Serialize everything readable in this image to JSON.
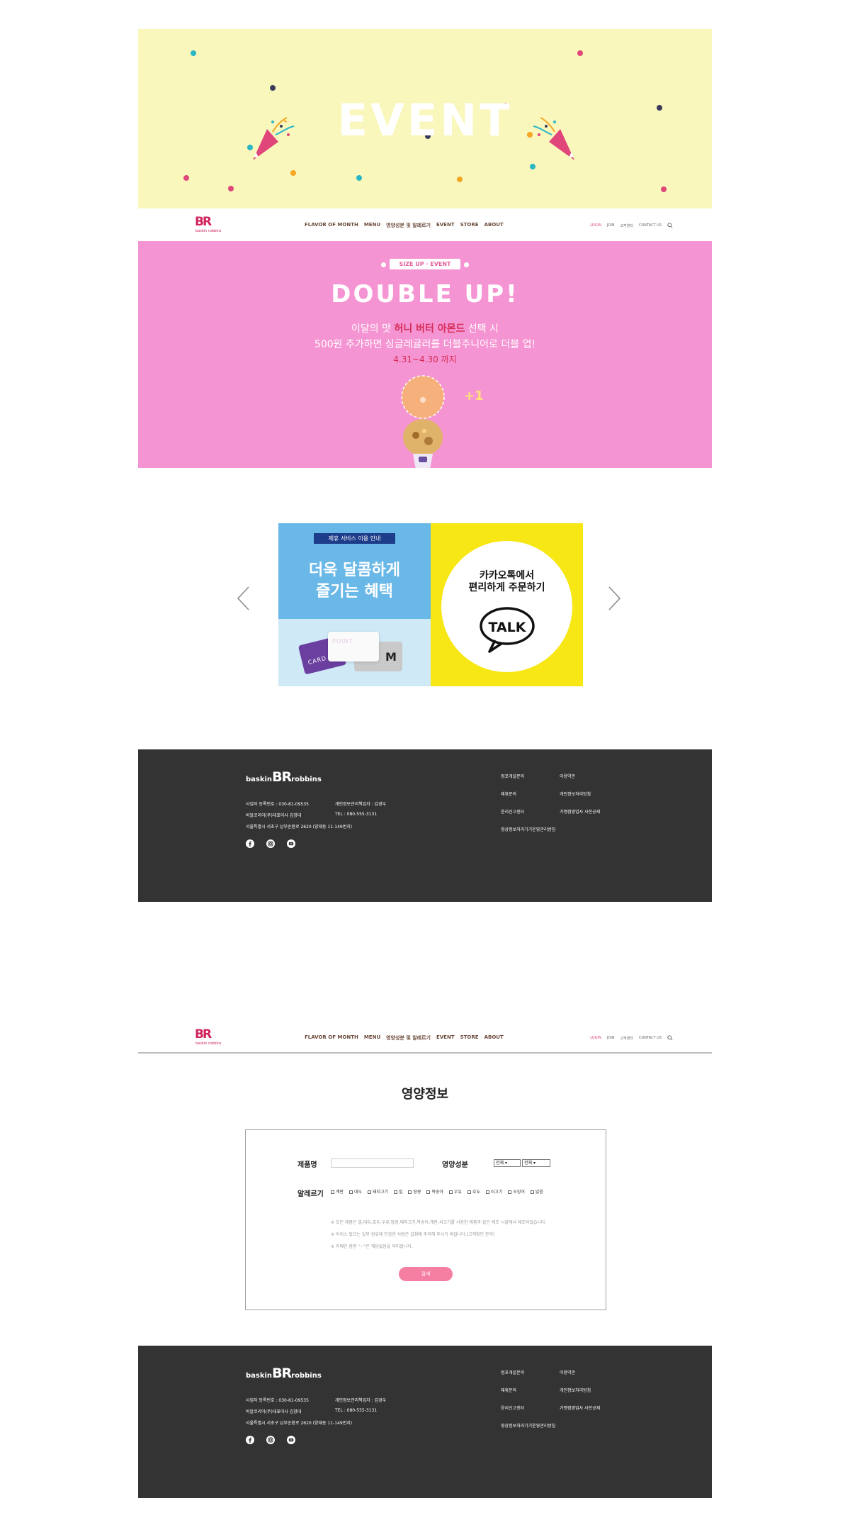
{
  "colors": {
    "hero_bg": "#f9f7bb",
    "promo_bg": "#f594d2",
    "footer_bg": "#333333",
    "brand_pink": "#d0245b",
    "brand_blue": "#2b4fa8",
    "search_button": "#f57ea3"
  },
  "hero": {
    "title": "EVENT"
  },
  "nav": {
    "logo_mark": "BR",
    "logo_sub": "baskin robbins",
    "menu": [
      "FLAVOR OF MONTH",
      "MENU",
      "영양성분 및 알레르기",
      "EVENT",
      "STORE",
      "ABOUT"
    ],
    "util": [
      "LOGIN",
      "JOIN",
      "고객센터",
      "CONTACT US"
    ],
    "search_icon": "search-icon"
  },
  "promo": {
    "badge": "SIZE UP · EVENT",
    "title": "DOUBLE  UP!",
    "line1_pre": "이달의 맛 ",
    "line1_highlight": "허니 버터 아몬드",
    "line1_post": " 선택 시",
    "line2": "500원 추가하면 싱글레귤러를 더블주니어로 더블 업!",
    "date": "4.31~4.30 까지",
    "plus": "+1"
  },
  "slider": {
    "left": {
      "ribbon": "제휴 서비스 이용 안내",
      "title_line1": "더욱 달콤하게",
      "title_line2": "즐기는 혜택",
      "card1": "CARD",
      "card2": "POINT",
      "card3": "M"
    },
    "right": {
      "line1": "카카오톡에서",
      "line2": "편리하게 주문하기",
      "talk": "TALK"
    }
  },
  "footer": {
    "logo_left": "baskin",
    "logo_mark": "BR",
    "logo_right": "robbins",
    "reg_no": "사업자 등록번호 : 030-81-09535",
    "privacy_officer": "개인정보관리책임자 : 김경우",
    "company": "비알코리아(주)대표이사 김창대",
    "tel": "TEL : 080-555-3131",
    "address": "서울특별시 서초구 남부순환로 2620 (양재동 11-149번지)",
    "links": [
      "점포개설문의",
      "이용약관",
      "제휴문의",
      "개인정보처리방침",
      "윤리신고센터",
      "가맹점영업사 사전공재",
      "영상정보처리기기운영관리방침"
    ],
    "social": [
      "facebook-icon",
      "instagram-icon",
      "youtube-icon"
    ]
  },
  "nutrition": {
    "title": "영양정보",
    "product_label": "제품명",
    "product_value": "",
    "nutrient_label": "영양성분",
    "select1": "전체",
    "select2": "전체",
    "allergy_label": "알레르기",
    "allergies": [
      "계란",
      "대두",
      "돼지고기",
      "밀",
      "땅콩",
      "복숭아",
      "우유",
      "호두",
      "쇠고기",
      "오징어",
      "없음"
    ],
    "note1": "※ 모든 제품은 밀,대두,호두,우유,땅콩,돼지고기,복숭아,계란,쇠고기를 사용한 제품과 같은 제조 시설에서 제조되었습니다.",
    "note2": "※ 아이스 밀크는 일부 원유에 민감한 사람은 섭취에 주의해 주시기 바랍니다.(고객확인 문의)",
    "note3": "※ 카페인 함량 \"ㅡ\"은 해당없음을 의미합니다.",
    "search_button": "검색"
  }
}
